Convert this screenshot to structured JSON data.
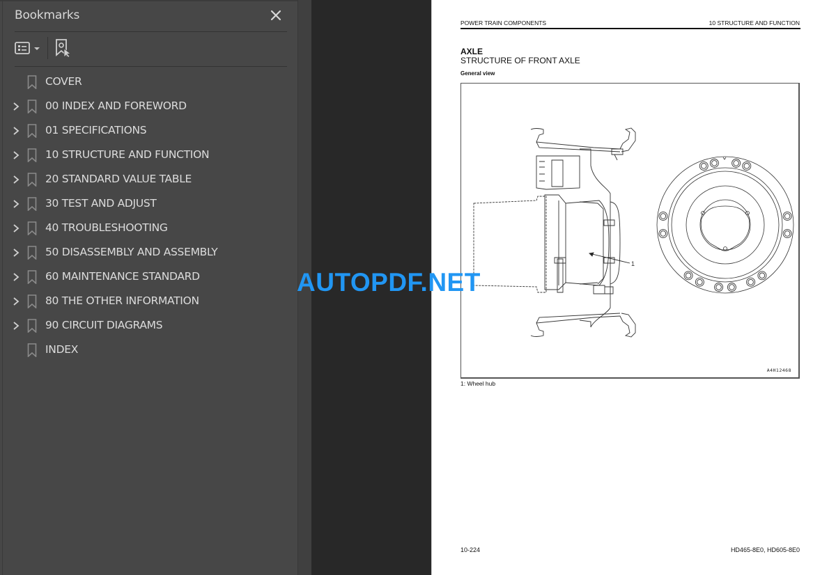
{
  "bookmarks_panel": {
    "title": "Bookmarks",
    "close_icon": "close-icon",
    "toolbar": {
      "options_icon": "list-options-icon",
      "find_icon": "find-current-bookmark-icon"
    },
    "items": [
      {
        "label": "COVER",
        "expandable": false
      },
      {
        "label": "00 INDEX AND FOREWORD",
        "expandable": true
      },
      {
        "label": "01 SPECIFICATIONS",
        "expandable": true
      },
      {
        "label": "10 STRUCTURE AND FUNCTION",
        "expandable": true
      },
      {
        "label": "20 STANDARD VALUE TABLE",
        "expandable": true
      },
      {
        "label": "30 TEST AND ADJUST",
        "expandable": true
      },
      {
        "label": "40 TROUBLESHOOTING",
        "expandable": true
      },
      {
        "label": "50 DISASSEMBLY AND ASSEMBLY",
        "expandable": true
      },
      {
        "label": "60 MAINTENANCE STANDARD",
        "expandable": true
      },
      {
        "label": "80 THE OTHER INFORMATION",
        "expandable": true
      },
      {
        "label": "90 CIRCUIT DIAGRAMS",
        "expandable": true
      },
      {
        "label": "INDEX",
        "expandable": false
      }
    ]
  },
  "page": {
    "header_left": "POWER TRAIN COMPONENTS",
    "header_right": "10 STRUCTURE AND FUNCTION",
    "section_title": "AXLE",
    "section_subtitle": "STRUCTURE OF FRONT AXLE",
    "subheading": "General view",
    "figure": {
      "callout": "1",
      "figure_code": "A4H12468"
    },
    "caption": "1: Wheel hub",
    "footer_left": "10-224",
    "footer_right": "HD465-8E0, HD605-8E0"
  },
  "watermark": {
    "text": "AUTOPDF.NET",
    "color": "#2196f3"
  }
}
